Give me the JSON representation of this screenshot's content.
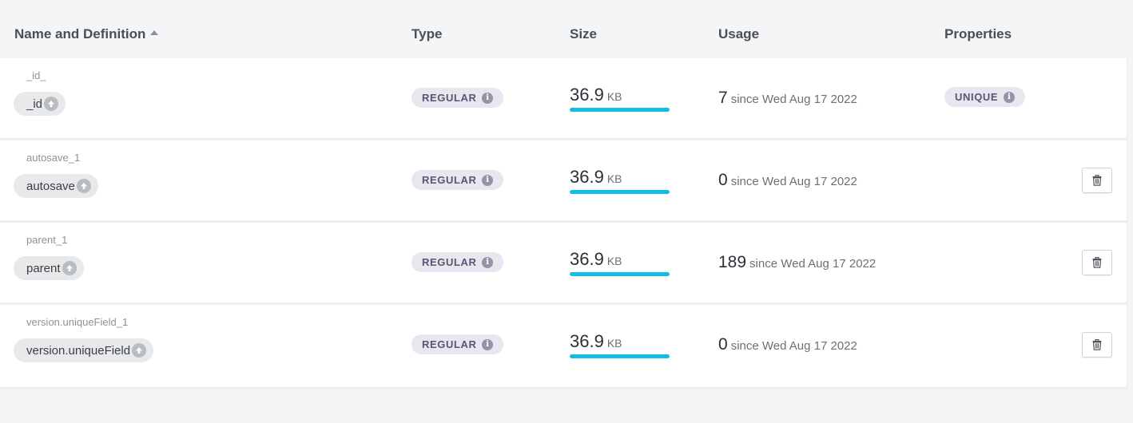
{
  "header": {
    "name_col": "Name and Definition",
    "type_col": "Type",
    "size_col": "Size",
    "usage_col": "Usage",
    "properties_col": "Properties"
  },
  "colors": {
    "size_bar": "#0fbde6",
    "badge_bg": "#e8e6ee",
    "pill_bg": "#e8e9eb"
  },
  "indexes": [
    {
      "index_name": "_id_",
      "field": "_id",
      "field_icon": "arrow-up-circle-icon",
      "type": "REGULAR",
      "size_value": "36.9",
      "size_unit": "KB",
      "size_fill_fraction": 1.0,
      "usage_count": "7",
      "usage_since": "since Wed Aug 17 2022",
      "property": "UNIQUE",
      "deletable": false
    },
    {
      "index_name": "autosave_1",
      "field": "autosave",
      "field_icon": "arrow-up-circle-icon",
      "type": "REGULAR",
      "size_value": "36.9",
      "size_unit": "KB",
      "size_fill_fraction": 1.0,
      "usage_count": "0",
      "usage_since": "since Wed Aug 17 2022",
      "property": "",
      "deletable": true
    },
    {
      "index_name": "parent_1",
      "field": "parent",
      "field_icon": "arrow-up-circle-icon",
      "type": "REGULAR",
      "size_value": "36.9",
      "size_unit": "KB",
      "size_fill_fraction": 1.0,
      "usage_count": "189",
      "usage_since": "since Wed Aug 17 2022",
      "property": "",
      "deletable": true
    },
    {
      "index_name": "version.uniqueField_1",
      "field": "version.uniqueField",
      "field_icon": "arrow-up-circle-icon",
      "type": "REGULAR",
      "size_value": "36.9",
      "size_unit": "KB",
      "size_fill_fraction": 1.0,
      "usage_count": "0",
      "usage_since": "since Wed Aug 17 2022",
      "property": "",
      "deletable": true
    }
  ]
}
